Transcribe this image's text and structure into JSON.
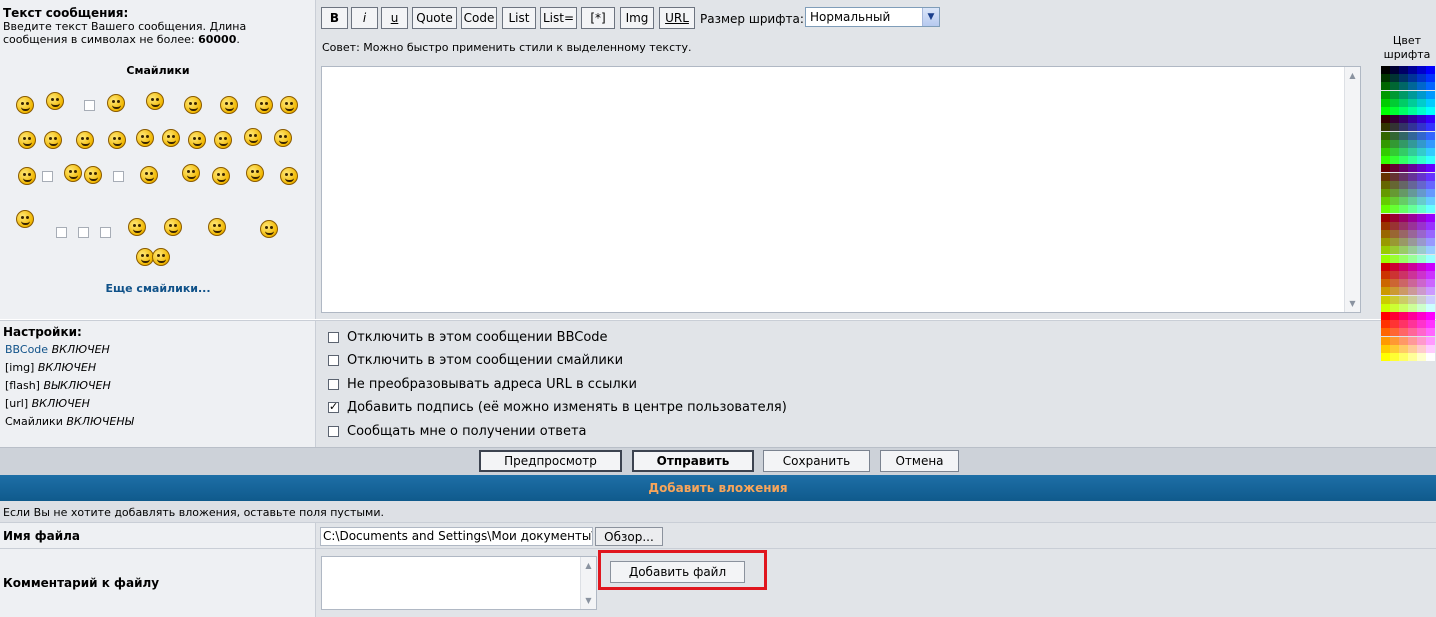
{
  "message": {
    "title": "Текст сообщения:",
    "desc_prefix": "Введите текст Вашего сообщения. Длина сообщения в символах не более: ",
    "max_len": "60000",
    "desc_suffix": "."
  },
  "smilies": {
    "title": "Смайлики",
    "more": "Еще смайлики..."
  },
  "toolbar": {
    "bold": "B",
    "italic": "i",
    "underline": "u",
    "quote": "Quote",
    "code": "Code",
    "list": "List",
    "list_eq": "List=",
    "list_item": "[*]",
    "img": "Img",
    "url": "URL",
    "font_size_label": "Размер шрифта:",
    "font_size_value": "Нормальный"
  },
  "hint": "Совет: Можно быстро применить стили к выделенному тексту.",
  "color_label": "Цвет шрифта",
  "palette": {
    "columns": 6,
    "colors": [
      "#000000",
      "#000033",
      "#000066",
      "#000099",
      "#0000cc",
      "#0000ff",
      "#003300",
      "#003333",
      "#003366",
      "#003399",
      "#0033cc",
      "#0033ff",
      "#006600",
      "#006633",
      "#006666",
      "#006699",
      "#0066cc",
      "#0066ff",
      "#009900",
      "#009933",
      "#009966",
      "#009999",
      "#0099cc",
      "#0099ff",
      "#00cc00",
      "#00cc33",
      "#00cc66",
      "#00cc99",
      "#00cccc",
      "#00ccff",
      "#00ff00",
      "#00ff33",
      "#00ff66",
      "#00ff99",
      "#00ffcc",
      "#00ffff",
      "#330000",
      "#330033",
      "#330066",
      "#330099",
      "#3300cc",
      "#3300ff",
      "#333300",
      "#333333",
      "#333366",
      "#333399",
      "#3333cc",
      "#3333ff",
      "#336600",
      "#336633",
      "#336666",
      "#336699",
      "#3366cc",
      "#3366ff",
      "#339900",
      "#339933",
      "#339966",
      "#339999",
      "#3399cc",
      "#3399ff",
      "#33cc00",
      "#33cc33",
      "#33cc66",
      "#33cc99",
      "#33cccc",
      "#33ccff",
      "#33ff00",
      "#33ff33",
      "#33ff66",
      "#33ff99",
      "#33ffcc",
      "#33ffff",
      "#660000",
      "#660033",
      "#660066",
      "#660099",
      "#6600cc",
      "#6600ff",
      "#663300",
      "#663333",
      "#663366",
      "#663399",
      "#6633cc",
      "#6633ff",
      "#666600",
      "#666633",
      "#666666",
      "#666699",
      "#6666cc",
      "#6666ff",
      "#669900",
      "#669933",
      "#669966",
      "#669999",
      "#6699cc",
      "#6699ff",
      "#66cc00",
      "#66cc33",
      "#66cc66",
      "#66cc99",
      "#66cccc",
      "#66ccff",
      "#66ff00",
      "#66ff33",
      "#66ff66",
      "#66ff99",
      "#66ffcc",
      "#66ffff",
      "#990000",
      "#990033",
      "#990066",
      "#990099",
      "#9900cc",
      "#9900ff",
      "#993300",
      "#993333",
      "#993366",
      "#993399",
      "#9933cc",
      "#9933ff",
      "#996600",
      "#996633",
      "#996666",
      "#996699",
      "#9966cc",
      "#9966ff",
      "#999900",
      "#999933",
      "#999966",
      "#999999",
      "#9999cc",
      "#9999ff",
      "#99cc00",
      "#99cc33",
      "#99cc66",
      "#99cc99",
      "#99cccc",
      "#99ccff",
      "#99ff00",
      "#99ff33",
      "#99ff66",
      "#99ff99",
      "#99ffcc",
      "#99ffff",
      "#cc0000",
      "#cc0033",
      "#cc0066",
      "#cc0099",
      "#cc00cc",
      "#cc00ff",
      "#cc3300",
      "#cc3333",
      "#cc3366",
      "#cc3399",
      "#cc33cc",
      "#cc33ff",
      "#cc6600",
      "#cc6633",
      "#cc6666",
      "#cc6699",
      "#cc66cc",
      "#cc66ff",
      "#cc9900",
      "#cc9933",
      "#cc9966",
      "#cc9999",
      "#cc99cc",
      "#cc99ff",
      "#cccc00",
      "#cccc33",
      "#cccc66",
      "#cccc99",
      "#cccccc",
      "#ccccff",
      "#ccff00",
      "#ccff33",
      "#ccff66",
      "#ccff99",
      "#ccffcc",
      "#ccffff",
      "#ff0000",
      "#ff0033",
      "#ff0066",
      "#ff0099",
      "#ff00cc",
      "#ff00ff",
      "#ff3300",
      "#ff3333",
      "#ff3366",
      "#ff3399",
      "#ff33cc",
      "#ff33ff",
      "#ff6600",
      "#ff6633",
      "#ff6666",
      "#ff6699",
      "#ff66cc",
      "#ff66ff",
      "#ff9900",
      "#ff9933",
      "#ff9966",
      "#ff9999",
      "#ff99cc",
      "#ff99ff",
      "#ffcc00",
      "#ffcc33",
      "#ffcc66",
      "#ffcc99",
      "#ffcccc",
      "#ffccff",
      "#ffff00",
      "#ffff33",
      "#ffff66",
      "#ffff99",
      "#ffffcc",
      "#ffffff"
    ]
  },
  "settings": {
    "title": "Настройки:",
    "bbcode_link": "BBCode",
    "bbcode_state": "ВКЛЮЧЕН",
    "img_label": "[img]",
    "img_state": "ВКЛЮЧЕН",
    "flash_label": "[flash]",
    "flash_state": "ВЫКЛЮЧЕН",
    "url_label": "[url]",
    "url_state": "ВКЛЮЧЕН",
    "smilies_label": "Смайлики",
    "smilies_state": "ВКЛЮЧЕНЫ"
  },
  "options": [
    {
      "label": "Отключить в этом сообщении BBCode",
      "checked": false
    },
    {
      "label": "Отключить в этом сообщении смайлики",
      "checked": false
    },
    {
      "label": "Не преобразовывать адреса URL в ссылки",
      "checked": false
    },
    {
      "label": "Добавить подпись (её можно изменять в центре пользователя)",
      "checked": true
    },
    {
      "label": "Сообщать мне о получении ответа",
      "checked": false
    }
  ],
  "buttons": {
    "preview": "Предпросмотр",
    "submit": "Отправить",
    "save": "Сохранить",
    "cancel": "Отмена"
  },
  "attachments": {
    "title": "Добавить вложения",
    "hint": "Если Вы не хотите добавлять вложения, оставьте поля пустыми.",
    "filename_label": "Имя файла",
    "filename_value": "C:\\Documents and Settings\\Мои документы\\",
    "browse": "Обзор...",
    "comment_label": "Комментарий к файлу",
    "add_file": "Добавить файл"
  },
  "colors": {
    "accent_header": "#1a6aa3",
    "attach_title": "#f8a55a",
    "link": "#105289",
    "highlight": "#e0161e"
  }
}
